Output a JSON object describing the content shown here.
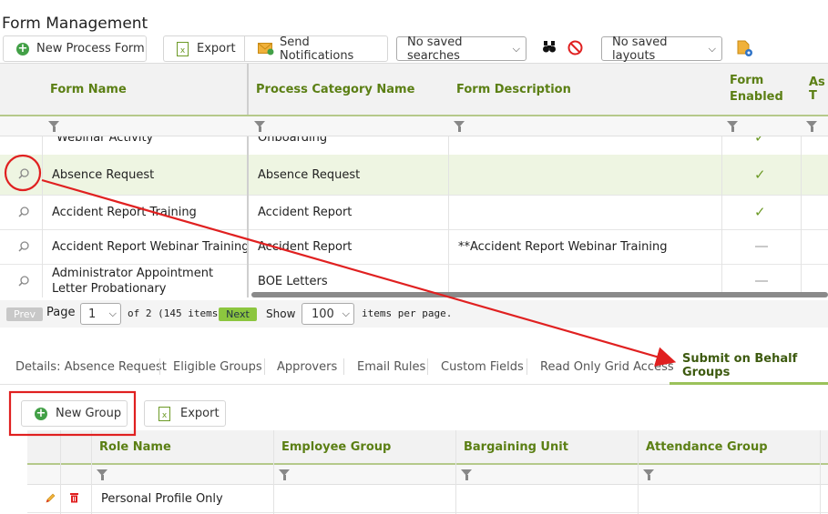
{
  "page": {
    "title": "Form Management"
  },
  "toolbar": {
    "new_process_form": "New Process Form",
    "export": "Export",
    "send_notifications": "Send Notifications",
    "saved_searches": "No saved searches",
    "saved_layouts": "No saved layouts"
  },
  "grid": {
    "columns": [
      "Form Name",
      "Process Category Name",
      "Form Description",
      "Form Enabled",
      "As T"
    ],
    "rows": [
      {
        "form_name": "Webinar Activity",
        "category": "Onboarding",
        "description": "",
        "enabled": "check"
      },
      {
        "form_name": "Absence Request",
        "category": "Absence Request",
        "description": "",
        "enabled": "check"
      },
      {
        "form_name": "Accident Report Training",
        "category": "Accident Report",
        "description": "",
        "enabled": "check"
      },
      {
        "form_name": "Accident Report Webinar Training",
        "category": "Accident Report",
        "description": "**Accident Report Webinar Training",
        "enabled": "dash"
      },
      {
        "form_name": "Administrator Appointment Letter Probationary",
        "category": "BOE Letters",
        "description": "",
        "enabled": "dash"
      }
    ]
  },
  "pager": {
    "prev": "Prev",
    "page_label": "Page",
    "page_value": "1",
    "of_text": "of 2 (145 items)",
    "next": "Next",
    "show_label": "Show",
    "show_value": "100",
    "per_page": "items per page."
  },
  "tabs": [
    "Details: Absence Request",
    "Eligible Groups",
    "Approvers",
    "Email Rules",
    "Custom Fields",
    "Read Only Grid Access",
    "Submit on Behalf Groups"
  ],
  "active_tab": "Submit on Behalf Groups",
  "sub_toolbar": {
    "new_group": "New Group",
    "export": "Export"
  },
  "sub_grid": {
    "columns": [
      "Role Name",
      "Employee Group",
      "Bargaining Unit",
      "Attendance Group"
    ],
    "rows": [
      {
        "role_name": "Personal Profile Only"
      }
    ]
  },
  "colors": {
    "accent_green": "#5b7f14",
    "highlight_row": "#eef5e2",
    "annotation_red": "#e02020",
    "next_btn": "#8cc63f"
  }
}
